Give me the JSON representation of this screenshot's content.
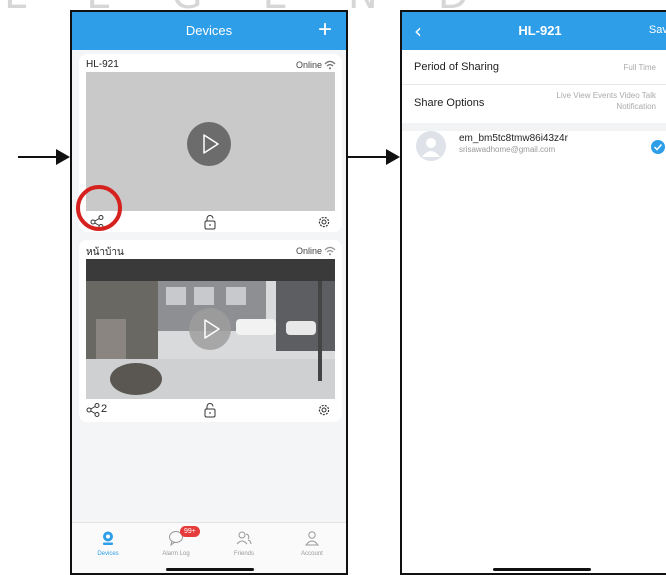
{
  "left_screen": {
    "header": {
      "title": "Devices",
      "add_label": "+"
    },
    "devices": [
      {
        "name": "HL-921",
        "status": "Online",
        "share_count": ""
      },
      {
        "name": "หน้าบ้าน",
        "status": "Online",
        "share_count": "2"
      }
    ],
    "tabs": [
      {
        "label": "Devices",
        "icon": "camera-icon",
        "active": true
      },
      {
        "label": "Alarm Log",
        "icon": "chat-bubble-icon",
        "badge": "99+"
      },
      {
        "label": "Friends",
        "icon": "friends-icon"
      },
      {
        "label": "Account",
        "icon": "person-icon"
      }
    ]
  },
  "right_screen": {
    "header": {
      "title": "HL-921",
      "save_label": "Save",
      "back_label": "‹"
    },
    "rows": [
      {
        "label": "Period of Sharing",
        "value": "Full Time"
      },
      {
        "label": "Share Options",
        "value": "Live View Events Video Talk Notification"
      }
    ],
    "user": {
      "name": "em_bm5tc8tmw86i43z4r",
      "email": "srisawadhome@gmail.com"
    }
  },
  "colors": {
    "accent": "#2e9ee9",
    "highlight_circle": "#d6221f",
    "badge": "#e63b3b"
  }
}
